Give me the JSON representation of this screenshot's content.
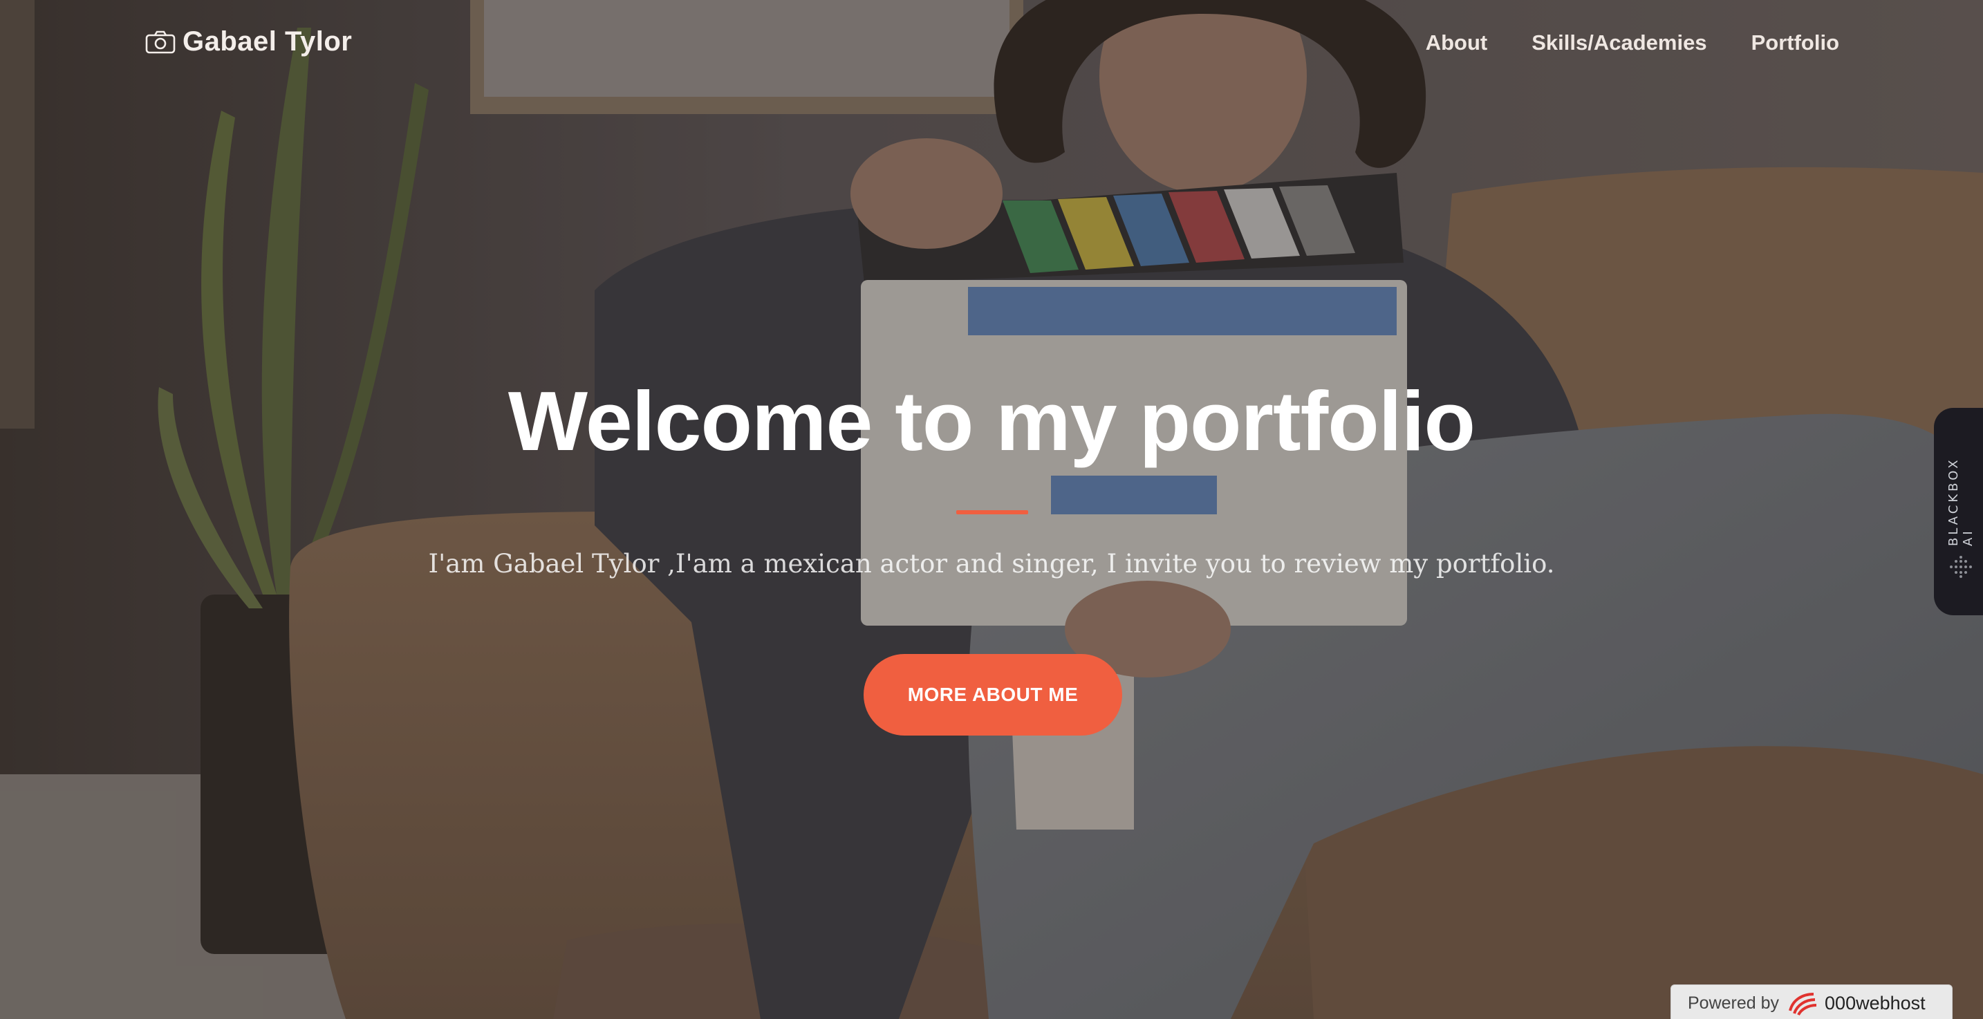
{
  "navbar": {
    "brand": "Gabael Tylor",
    "brand_icon": "camera-icon",
    "links": [
      "About",
      "Skills/Academies",
      "Portfolio"
    ]
  },
  "hero": {
    "title": "Welcome to my portfolio",
    "subtitle": "I'am Gabael Tylor ,I'am a mexican actor and singer, I invite you to review my portfolio.",
    "cta_label": "MORE ABOUT ME",
    "accent_color": "#f05f40"
  },
  "side_widget": {
    "label": "BLACKBOX AI",
    "icon": "dots-grid-icon"
  },
  "footer_badge": {
    "powered_label": "Powered by",
    "host_name": "000webhost",
    "icon": "webhost-logo-icon"
  }
}
